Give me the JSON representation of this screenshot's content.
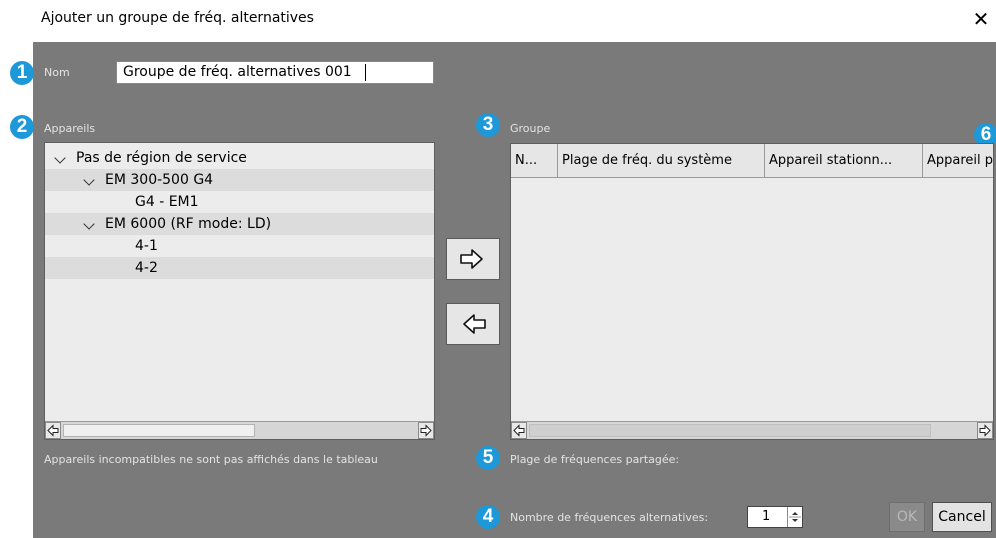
{
  "window": {
    "title": "Ajouter un groupe de fréq. alternatives",
    "close_glyph": "✕"
  },
  "badges": {
    "b1": "1",
    "b2": "2",
    "b3": "3",
    "b4": "4",
    "b5": "5",
    "b6": "6"
  },
  "name_field": {
    "label": "Nom",
    "value": "Groupe de fréq. alternatives 001"
  },
  "devices": {
    "label": "Appareils",
    "tree": [
      {
        "label": "Pas de région de service"
      },
      {
        "label": "EM 300-500 G4"
      },
      {
        "label": "G4 - EM1"
      },
      {
        "label": "EM 6000 (RF mode: LD)"
      },
      {
        "label": "4-1"
      },
      {
        "label": "4-2"
      }
    ],
    "note": "Appareils incompatibles ne sont pas affichés dans le tableau"
  },
  "group": {
    "label": "Groupe",
    "columns": [
      "N...",
      "Plage de fréq. du système",
      "Appareil stationn...",
      "Appareil p"
    ]
  },
  "shared_range": {
    "label": "Plage de fréquences partagée:"
  },
  "alt_count": {
    "label": "Nombre de fréquences alternatives:",
    "value": "1"
  },
  "buttons": {
    "ok": "OK",
    "cancel": "Cancel"
  },
  "icons": {
    "close": "close-icon",
    "add": "arrow-right-icon",
    "remove": "arrow-left-icon",
    "scroll_left": "scroll-left-arrow-icon",
    "scroll_right": "scroll-right-arrow-icon",
    "expand": "chevron-down-icon"
  },
  "colors": {
    "dialog_bg": "#7a7a7a",
    "panel_bg": "#ececec",
    "badge": "#1d98d8"
  }
}
